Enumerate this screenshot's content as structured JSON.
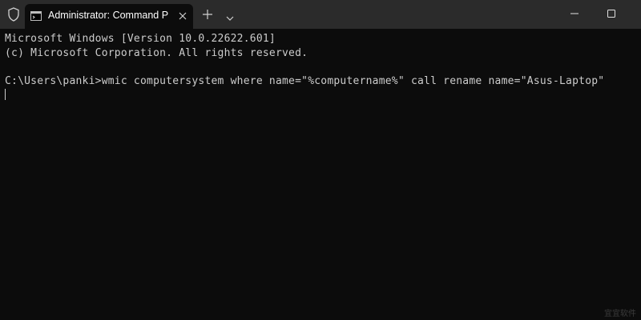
{
  "titlebar": {
    "tab_title": "Administrator: Command Pro",
    "icons": {
      "shield": "shield-icon",
      "terminal": "terminal-icon",
      "close_tab": "close-icon",
      "new_tab": "plus-icon",
      "dropdown": "chevron-down-icon",
      "minimize": "minimize-icon",
      "maximize": "maximize-icon",
      "close_window": "close-icon"
    }
  },
  "console": {
    "lines": [
      "Microsoft Windows [Version 10.0.22622.601]",
      "(c) Microsoft Corporation. All rights reserved.",
      "C:\\Users\\panki>wmic computersystem where name=\"%computername%\" call rename name=\"Asus-Laptop\""
    ],
    "text_color": "#cccccc",
    "background": "#0c0c0c"
  },
  "watermark": "宜宜软件"
}
